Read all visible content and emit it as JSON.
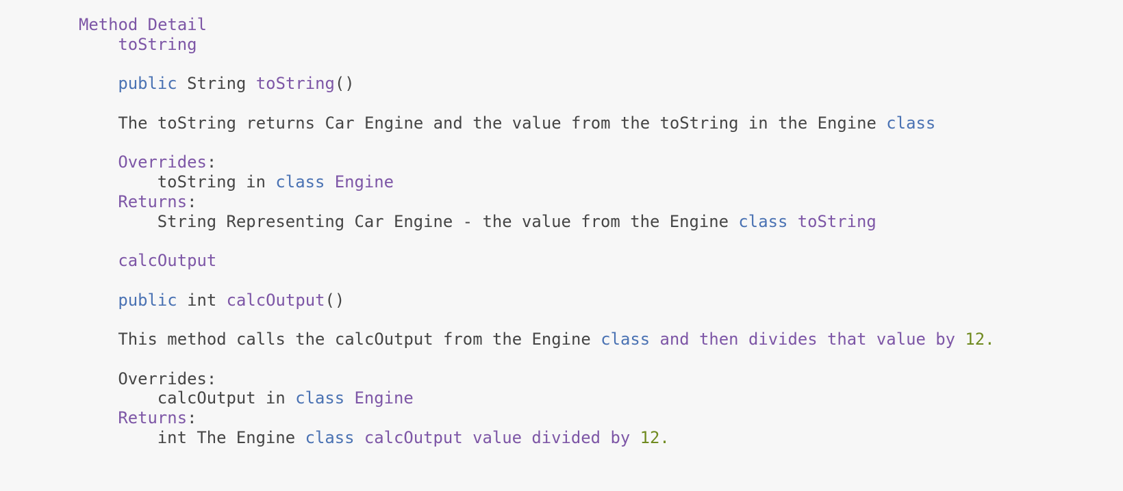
{
  "section_title": "Method Detail",
  "colors": {
    "keyword": "#4a72b3",
    "identifier": "#7d56a6",
    "number": "#6f8a1f",
    "text": "#454545",
    "background": "#f7f7f7"
  },
  "methods": [
    {
      "name": "toString",
      "signature": {
        "modifier": "public",
        "return_type": "String",
        "name": "toString",
        "params": "()"
      },
      "description": {
        "text": "The toString returns Car Engine and the value from the toString in the Engine ",
        "keyword": "class"
      },
      "overrides": {
        "label": "Overrides",
        "colon": ":",
        "method": "toString",
        "in": " in ",
        "keyword": "class",
        "class_name": "Engine"
      },
      "returns": {
        "label": "Returns",
        "colon": ":",
        "text": "String Representing Car Engine - the value from the Engine ",
        "keyword": "class",
        "tail": "toString"
      }
    },
    {
      "name": "calcOutput",
      "signature": {
        "modifier": "public",
        "return_type": "int",
        "name": "calcOutput",
        "params": "()"
      },
      "description": {
        "text": "This method calls the calcOutput from the Engine ",
        "keyword": "class",
        "tail": " and then divides that value by ",
        "number": "12."
      },
      "overrides": {
        "label": "Overrides:",
        "method": "calcOutput",
        "in": " in ",
        "keyword": "class",
        "class_name": "Engine"
      },
      "returns": {
        "label": "Returns",
        "colon": ":",
        "text": "int The Engine ",
        "keyword": "class",
        "tail": " calcOutput value divided by ",
        "number": "12."
      }
    }
  ]
}
